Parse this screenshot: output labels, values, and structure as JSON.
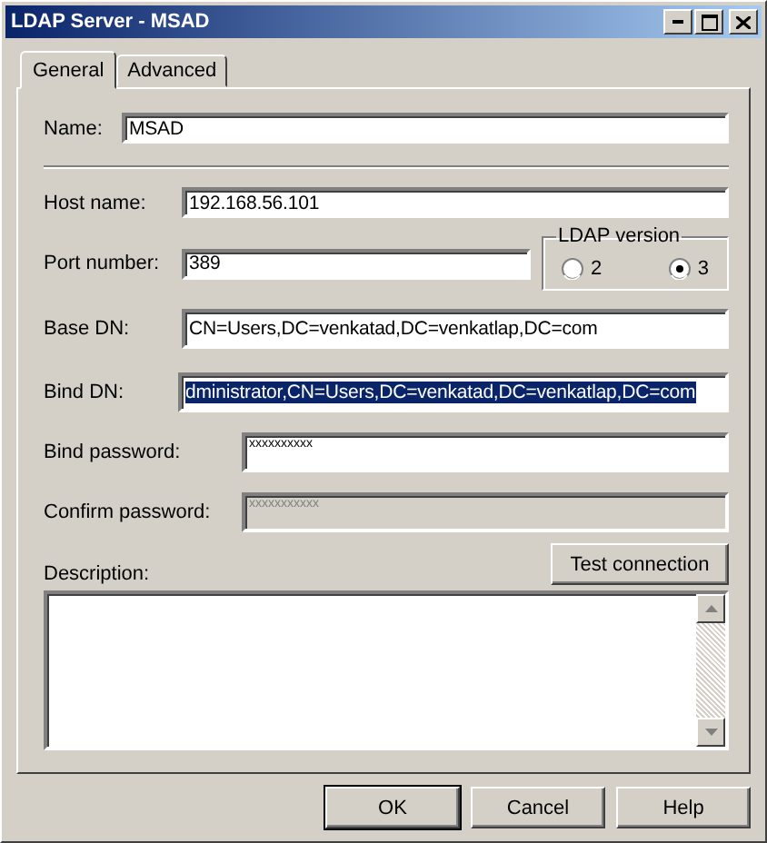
{
  "window": {
    "title": "LDAP Server - MSAD"
  },
  "tabs": [
    {
      "label": "General",
      "selected": true
    },
    {
      "label": "Advanced",
      "selected": false
    }
  ],
  "name": {
    "label": "Name:",
    "value": "MSAD"
  },
  "host": {
    "label": "Host name:",
    "value": "192.168.56.101"
  },
  "port": {
    "label": "Port number:",
    "value": "389"
  },
  "ldap_version": {
    "label": "LDAP version",
    "options": [
      {
        "label": "2",
        "selected": false
      },
      {
        "label": "3",
        "selected": true
      }
    ]
  },
  "base_dn": {
    "label": "Base DN:",
    "value": "CN=Users,DC=venkatad,DC=venkatlap,DC=com"
  },
  "bind_dn": {
    "label": "Bind DN:",
    "value": "dministrator,CN=Users,DC=venkatad,DC=venkatlap,DC=com",
    "text_selected": true
  },
  "bind_password": {
    "label": "Bind password:",
    "value": "xxxxxxxxxx",
    "disabled": false
  },
  "confirm_password": {
    "label": "Confirm password:",
    "value": "xxxxxxxxxxx",
    "disabled": true
  },
  "test_button": {
    "label": "Test connection"
  },
  "description": {
    "label": "Description:"
  },
  "buttons": [
    {
      "label": "OK",
      "default": true
    },
    {
      "label": "Cancel",
      "default": false
    },
    {
      "label": "Help",
      "default": false
    }
  ]
}
